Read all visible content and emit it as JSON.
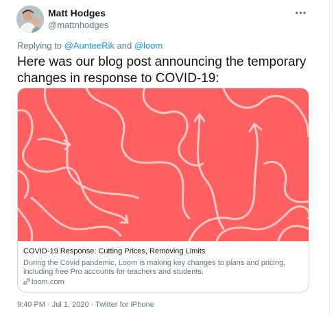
{
  "tweet": {
    "author_name": "Matt Hodges",
    "author_handle": "@mattnhodges",
    "more_label": "•••",
    "replying_prefix": "Replying to",
    "reply_user_1": "@AunteeRik",
    "reply_and": "and",
    "reply_user_2": "@loom",
    "text": "Here was our blog post announcing the temporary changes in response to COVID-19:",
    "timestamp": "9:40 PM · Jul 1, 2020",
    "separator": " · ",
    "source": "Twitter for iPhone"
  },
  "card": {
    "title": "COVID-19 Response: Cutting Prices, Removing Limits",
    "description": "During the Covid pandemic, Loom is making key changes to plans and pricing, including free Pro accounts for teachers and students.",
    "domain": "loom.com",
    "image_bg": "#ff6163",
    "line_color": "#ffc7c5"
  },
  "colors": {
    "link": "#1b95e0",
    "secondary": "#657786",
    "text": "#14171a"
  },
  "icons": {
    "more": "more-horizontal-icon",
    "link": "link-icon"
  }
}
